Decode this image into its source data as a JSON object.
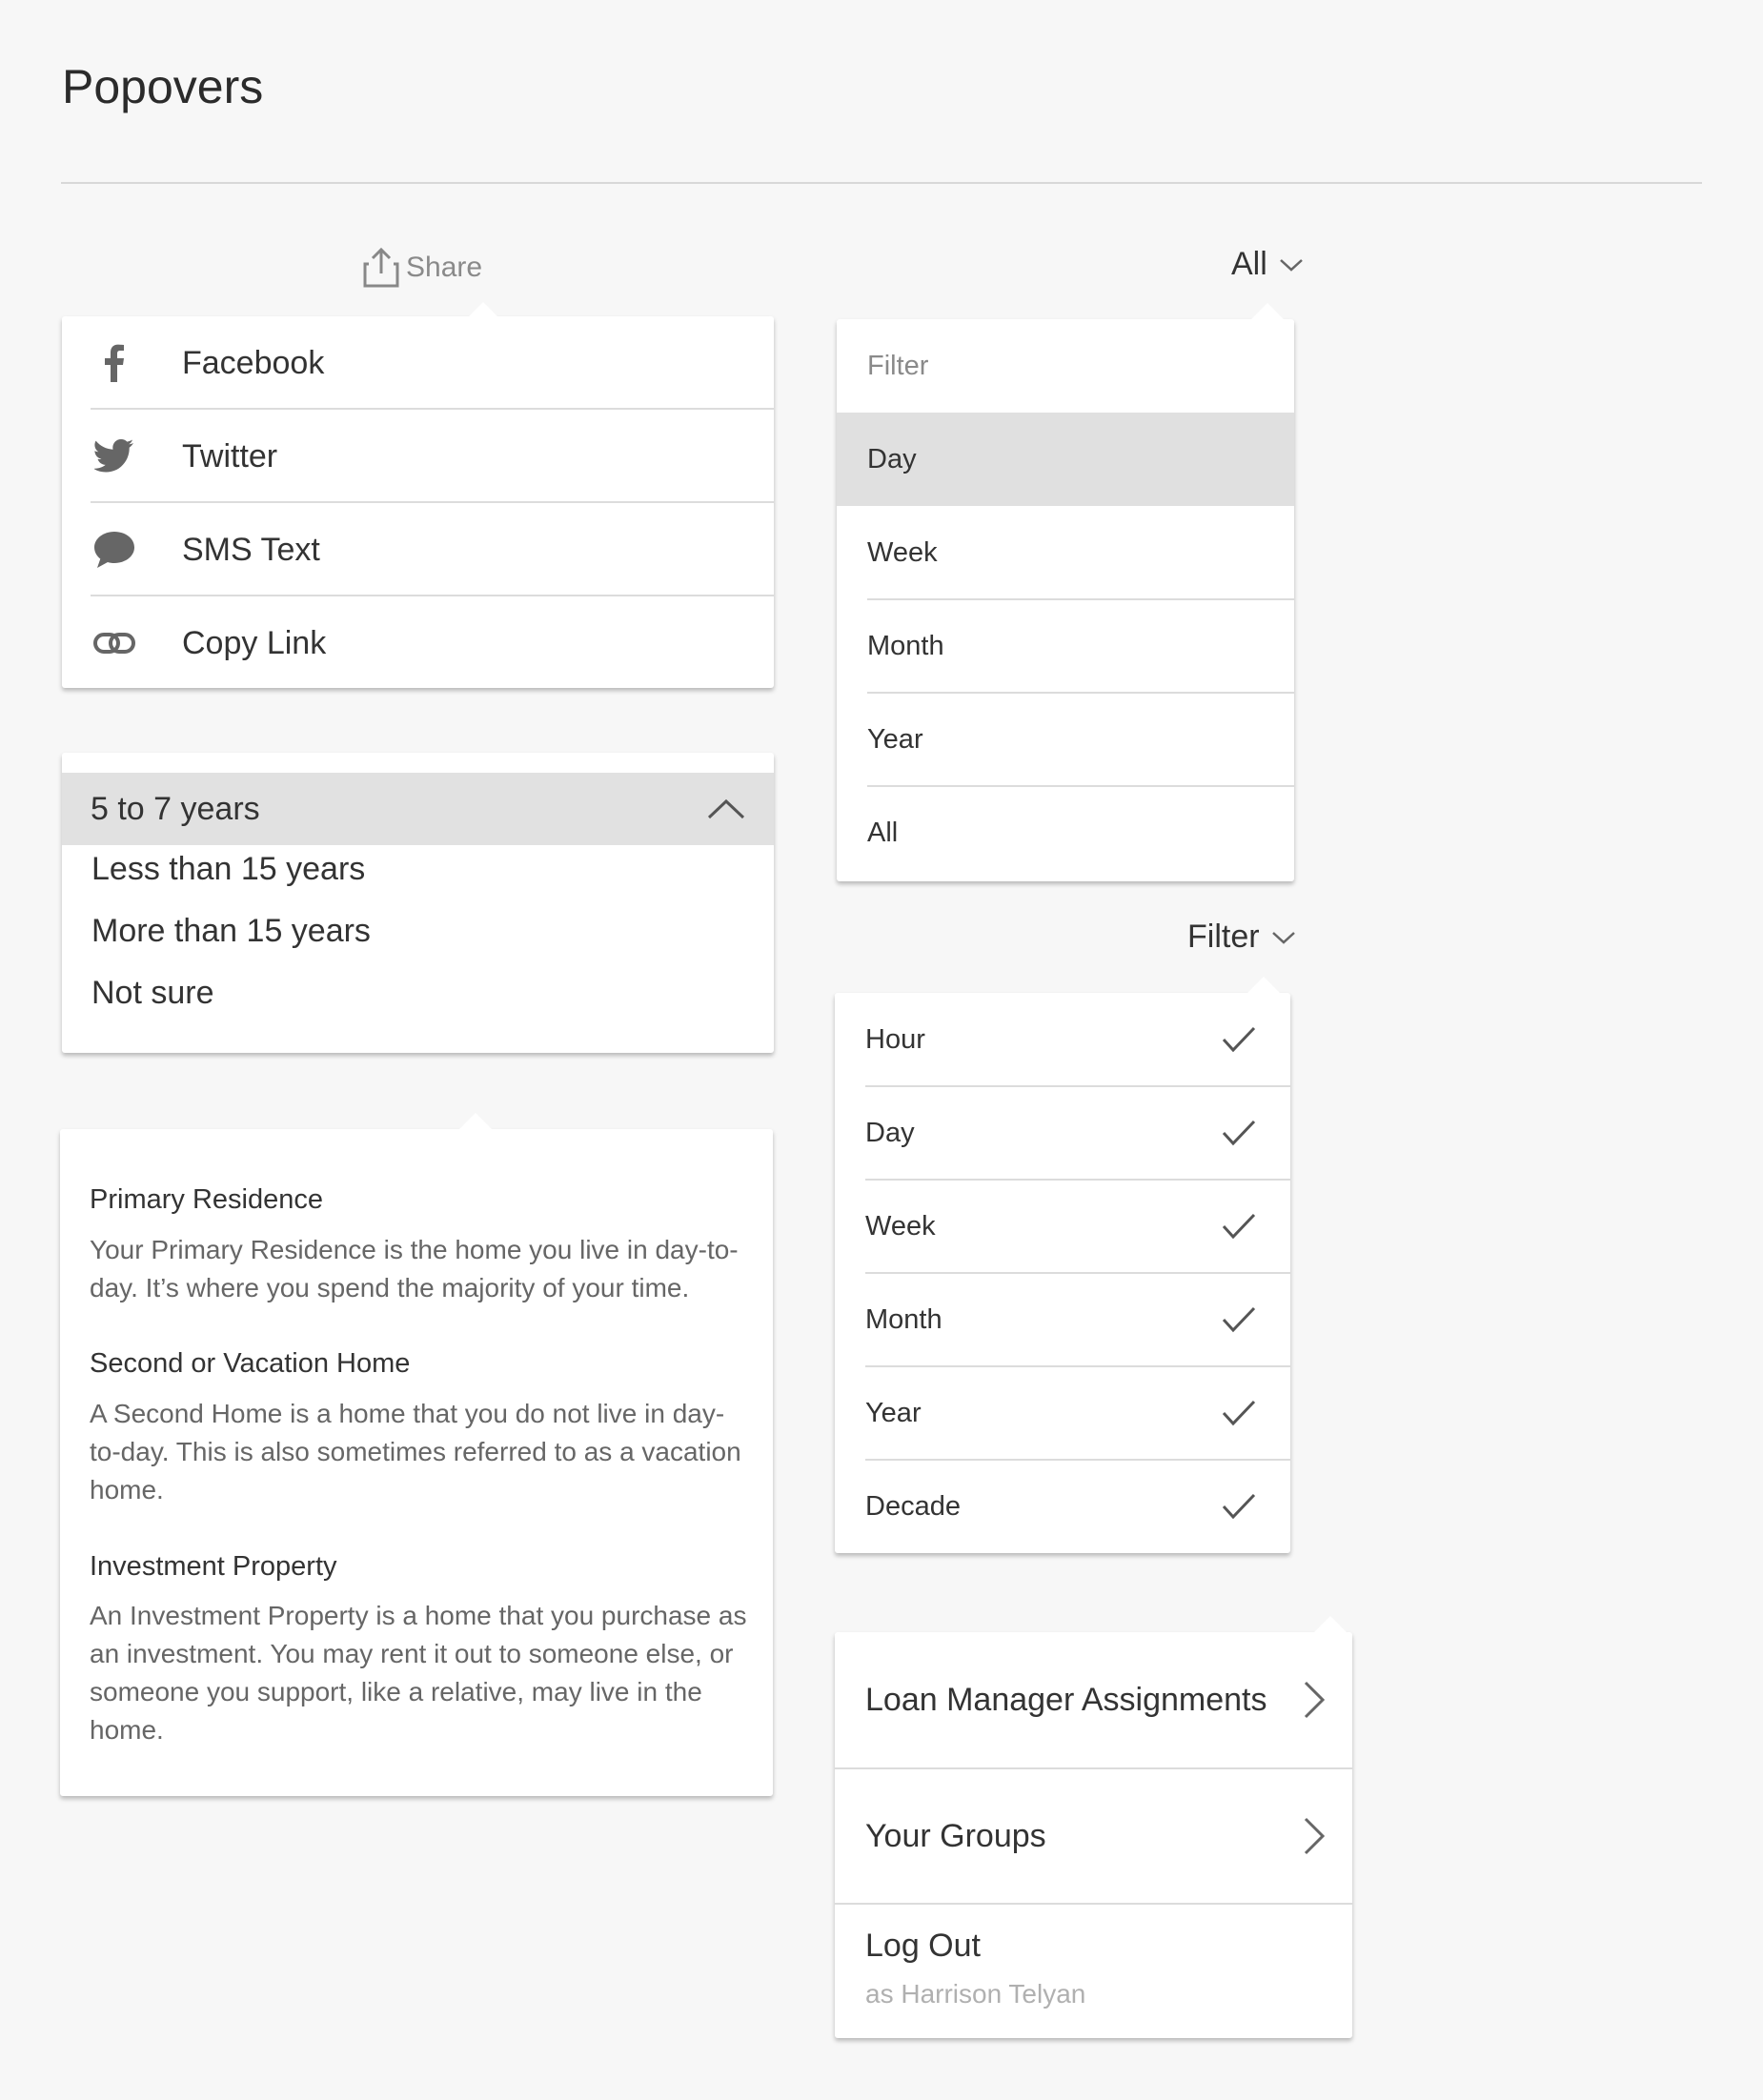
{
  "page": {
    "title": "Popovers"
  },
  "share": {
    "trigger_label": "Share",
    "items": [
      {
        "label": "Facebook",
        "icon": "facebook-icon"
      },
      {
        "label": "Twitter",
        "icon": "twitter-icon"
      },
      {
        "label": "SMS Text",
        "icon": "chat-bubble-icon"
      },
      {
        "label": "Copy Link",
        "icon": "link-icon"
      }
    ]
  },
  "years": {
    "selected": "5 to 7 years",
    "options": [
      "Less than 15 years",
      "More than 15 years",
      "Not sure"
    ]
  },
  "info": {
    "sections": [
      {
        "heading": "Primary Residence",
        "body": "Your Primary Residence is the home you live in day-to-day. It’s where you spend the majority of your time."
      },
      {
        "heading": "Second or Vacation Home",
        "body": "A Second Home is a home that you do not live in day-to-day. This is also sometimes referred to as a vacation home."
      },
      {
        "heading": "Investment Property",
        "body": "An Investment Property is a home that you purchase as an investment. You may rent it out to someone else, or someone you support, like a relative, may live in the home."
      }
    ]
  },
  "period_filter": {
    "trigger_label": "All",
    "search_placeholder": "Filter",
    "options": [
      "Day",
      "Week",
      "Month",
      "Year",
      "All"
    ],
    "highlighted": "Day"
  },
  "multi_filter": {
    "trigger_label": "Filter",
    "options": [
      "Hour",
      "Day",
      "Week",
      "Month",
      "Year",
      "Decade"
    ]
  },
  "account_menu": {
    "items": [
      "Loan Manager Assignments",
      "Your Groups"
    ],
    "logout_label": "Log Out",
    "logout_sub": "as Harrison Telyan"
  }
}
